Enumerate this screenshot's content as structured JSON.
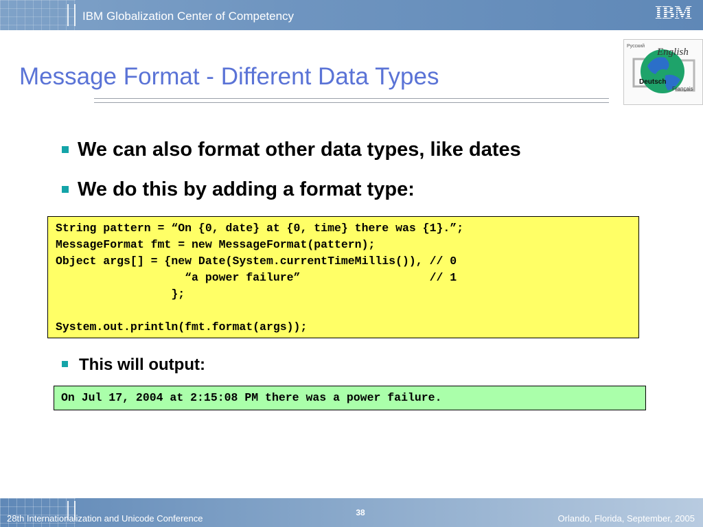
{
  "header": {
    "title": "IBM Globalization Center of Competency",
    "logo_text": "IBM"
  },
  "slide": {
    "title": "Message Format - Different Data Types",
    "bullets": [
      "We can also format other data types, like dates",
      "We do this by adding a format type:"
    ],
    "code_lines": [
      "String pattern = “On {0, date} at {0, time} there was {1}.”;",
      "MessageFormat fmt = new MessageFormat(pattern);",
      "Object args[] = {new Date(System.currentTimeMillis()), // 0",
      "                   “a power failure”                   // 1",
      "                 };",
      "",
      "System.out.println(fmt.format(args));"
    ],
    "output_bullet": "This will output:",
    "output_line": "On Jul 17, 2004 at 2:15:08 PM there was a power failure."
  },
  "globe_logo": {
    "labels": [
      "Русский",
      "English",
      "Deutsch",
      "Français"
    ]
  },
  "footer": {
    "left": "28th Internationalization and Unicode Conference",
    "page_number": "38",
    "right": "Orlando, Florida, September, 2005"
  },
  "colors": {
    "title": "#5a73d6",
    "bullet_marker": "#14a4a8",
    "code_background": "#ffff66",
    "output_background": "#aaffaa",
    "header_bar": "#6f95c0"
  }
}
